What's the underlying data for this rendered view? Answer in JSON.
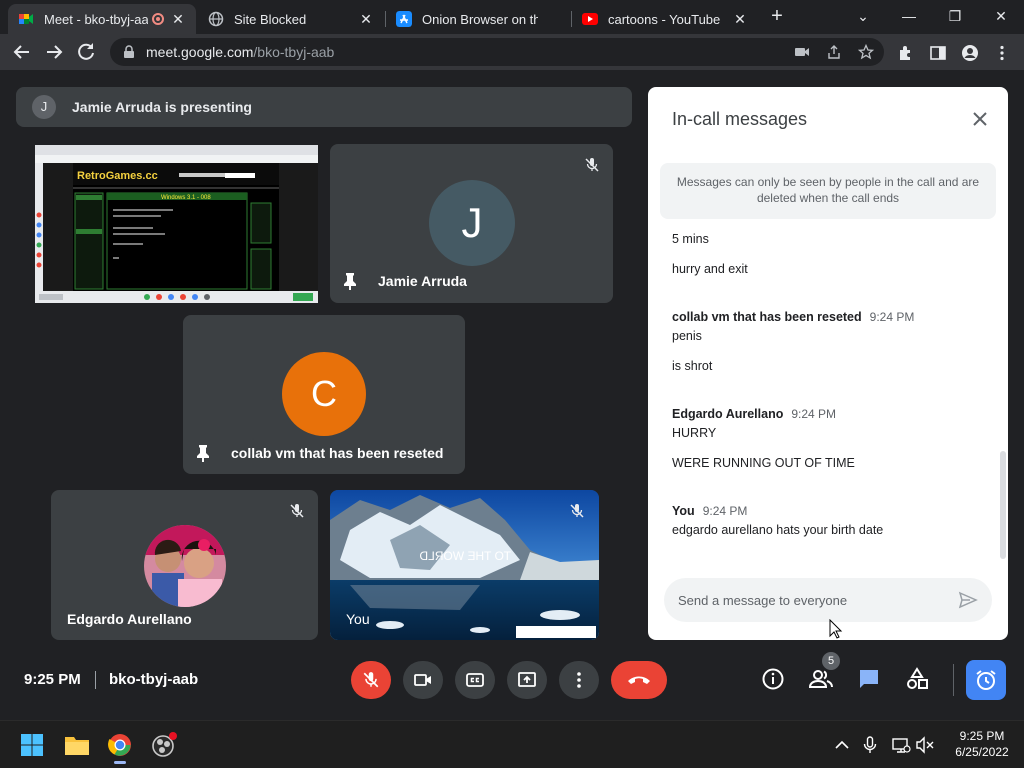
{
  "browser": {
    "tabs": [
      {
        "title": "Meet - bko-tbyj-aab",
        "active": true
      },
      {
        "title": "Site Blocked",
        "active": false
      },
      {
        "title": "Onion Browser on the App",
        "active": false
      },
      {
        "title": "cartoons - YouTube",
        "active": false
      }
    ],
    "url_host": "meet.google.com",
    "url_path": "/bko-tbyj-aab"
  },
  "meet": {
    "presenting_initial": "J",
    "presenting_text": "Jamie Arruda is presenting",
    "participants": [
      {
        "name": "Jamie Arruda",
        "initial": "J"
      },
      {
        "name": "collab vm that has been reseted",
        "initial": "C"
      },
      {
        "name": "Edgardo Aurellano"
      },
      {
        "name": "You"
      }
    ],
    "shared_screen_text": {
      "site": "RetroGames.cc",
      "headline": "Windows 3.1 - 008"
    },
    "you_tile_overlay": "TO THE WORLD"
  },
  "chat": {
    "title": "In-call messages",
    "notice": "Messages can only be seen by people in the call and are deleted when the call ends",
    "groups": [
      {
        "sender": null,
        "time": null,
        "messages": [
          "5 mins",
          "hurry and exit"
        ]
      },
      {
        "sender": "collab vm that has been reseted",
        "time": "9:24 PM",
        "messages": [
          "penis",
          "is shrot"
        ]
      },
      {
        "sender": "Edgardo Aurellano",
        "time": "9:24 PM",
        "messages": [
          "HURRY",
          "WERE RUNNING OUT OF TIME"
        ]
      },
      {
        "sender": "You",
        "time": "9:24 PM",
        "messages": [
          "edgardo aurellano hats your birth date"
        ]
      }
    ],
    "input_placeholder": "Send a message to everyone"
  },
  "controls": {
    "time": "9:25 PM",
    "meeting_code": "bko-tbyj-aab",
    "people_count": "5"
  },
  "taskbar": {
    "time": "9:25 PM",
    "date": "6/25/2022"
  },
  "colors": {
    "background": "#202124",
    "tile": "#3c4043",
    "accent_blue": "#4285f4",
    "danger_red": "#ea4335",
    "avatar_orange": "#e8710a",
    "avatar_slate": "#455a64"
  }
}
